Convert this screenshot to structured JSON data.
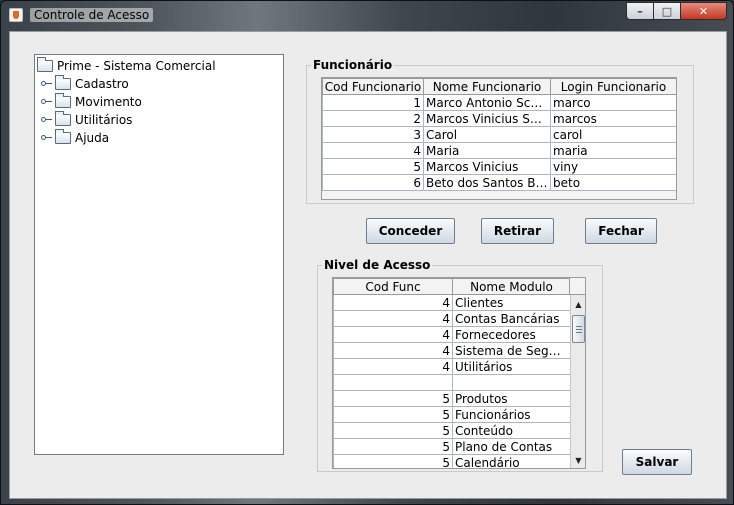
{
  "window": {
    "title": "Controle de Acesso",
    "controls": {
      "minimize": "–",
      "maximize": "□",
      "close": "✕"
    }
  },
  "tree": {
    "root": "Prime - Sistema Comercial",
    "items": [
      "Cadastro",
      "Movimento",
      "Utilitários",
      "Ajuda"
    ]
  },
  "funcionario": {
    "legend": "Funcionário",
    "columns": [
      "Cod Funcionario",
      "Nome Funcionario",
      "Login Funcionario"
    ],
    "rows": [
      [
        "1",
        "Marco Antonio Scholl",
        "marco"
      ],
      [
        "2",
        "Marcos Vinicius Scholl",
        "marcos"
      ],
      [
        "3",
        "Carol",
        "carol"
      ],
      [
        "4",
        "Maria",
        "maria"
      ],
      [
        "5",
        "Marcos Vinicius",
        "viny"
      ],
      [
        "6",
        "Beto dos Santos Brito",
        "beto"
      ]
    ]
  },
  "buttons": {
    "conceder": "Conceder",
    "retirar": "Retirar",
    "fechar": "Fechar",
    "salvar": "Salvar"
  },
  "nivel": {
    "legend": "Nivel de Acesso",
    "columns": [
      "Cod Func",
      "Nome Modulo"
    ],
    "rows": [
      [
        "4",
        "Clientes"
      ],
      [
        "4",
        "Contas Bancárias"
      ],
      [
        "4",
        "Fornecedores"
      ],
      [
        "4",
        "Sistema de Segura..."
      ],
      [
        "4",
        "Utilitários"
      ],
      [
        "",
        ""
      ],
      [
        "5",
        "Produtos"
      ],
      [
        "5",
        "Funcionários"
      ],
      [
        "5",
        "Conteúdo"
      ],
      [
        "5",
        "Plano de Contas"
      ],
      [
        "5",
        "Calendário"
      ]
    ]
  }
}
